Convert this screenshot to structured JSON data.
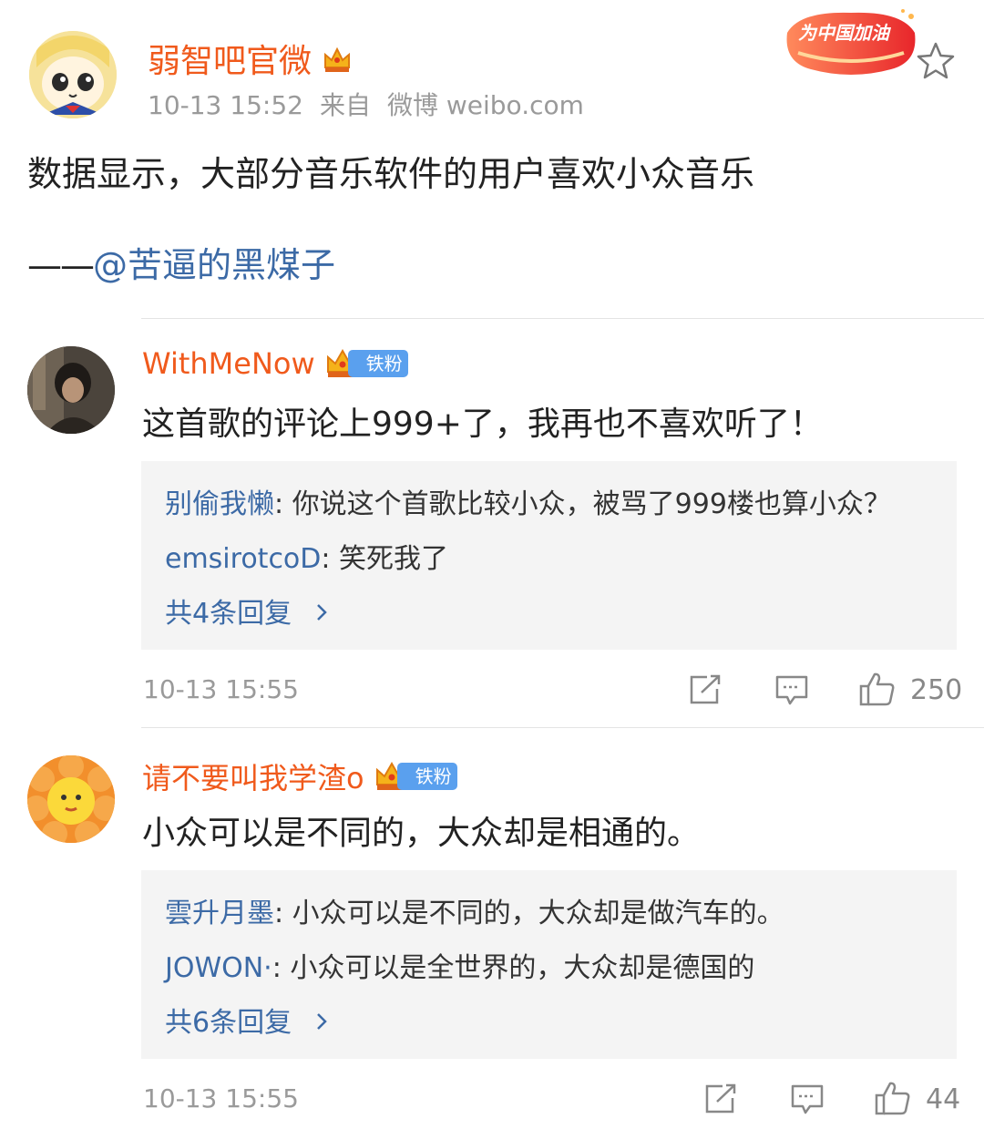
{
  "post": {
    "author": "弱智吧官微",
    "time": "10-13 15:52",
    "source_prefix": "来自",
    "source": "微博 weibo.com",
    "text": "数据显示，大部分音乐软件的用户喜欢小众音乐",
    "attribution_dash": "——",
    "attribution_user": "@苦逼的黑煤子",
    "banner_text": "为中国加油"
  },
  "comments": [
    {
      "user": "WithMeNow",
      "badge": "铁粉",
      "text": "这首歌的评论上999+了，我再也不喜欢听了！",
      "replies": [
        {
          "user": "别偷我懒",
          "sep": ": ",
          "text": "你说这个首歌比较小众，被骂了999楼也算小众？"
        },
        {
          "user": "emsirotcoD",
          "sep": ": ",
          "text": "笑死我了"
        }
      ],
      "more_replies": "共4条回复",
      "time": "10-13 15:55",
      "likes": "250"
    },
    {
      "user": "请不要叫我学渣o",
      "badge": "铁粉",
      "text": "小众可以是不同的，大众却是相通的。",
      "replies": [
        {
          "user": "雲升月墨",
          "sep": ": ",
          "text": "小众可以是不同的，大众却是做汽车的。"
        },
        {
          "user": "JOWON·",
          "sep": ": ",
          "text": "小众可以是全世界的，大众却是德国的"
        }
      ],
      "more_replies": "共6条回复",
      "time": "10-13 15:55",
      "likes": "44"
    }
  ],
  "colors": {
    "name_orange": "#f05a1c",
    "link_blue": "#3c6aa6",
    "meta_gray": "#9a9a9a",
    "reply_bg": "#f4f4f4",
    "badge_blue": "#5aa0ee"
  },
  "icons": {
    "crown": "crown-icon",
    "favorite": "star-outline-icon",
    "repost": "share-box-icon",
    "comment": "comment-bubble-icon",
    "like": "thumbs-up-icon",
    "chevron": "chevron-right-icon"
  }
}
